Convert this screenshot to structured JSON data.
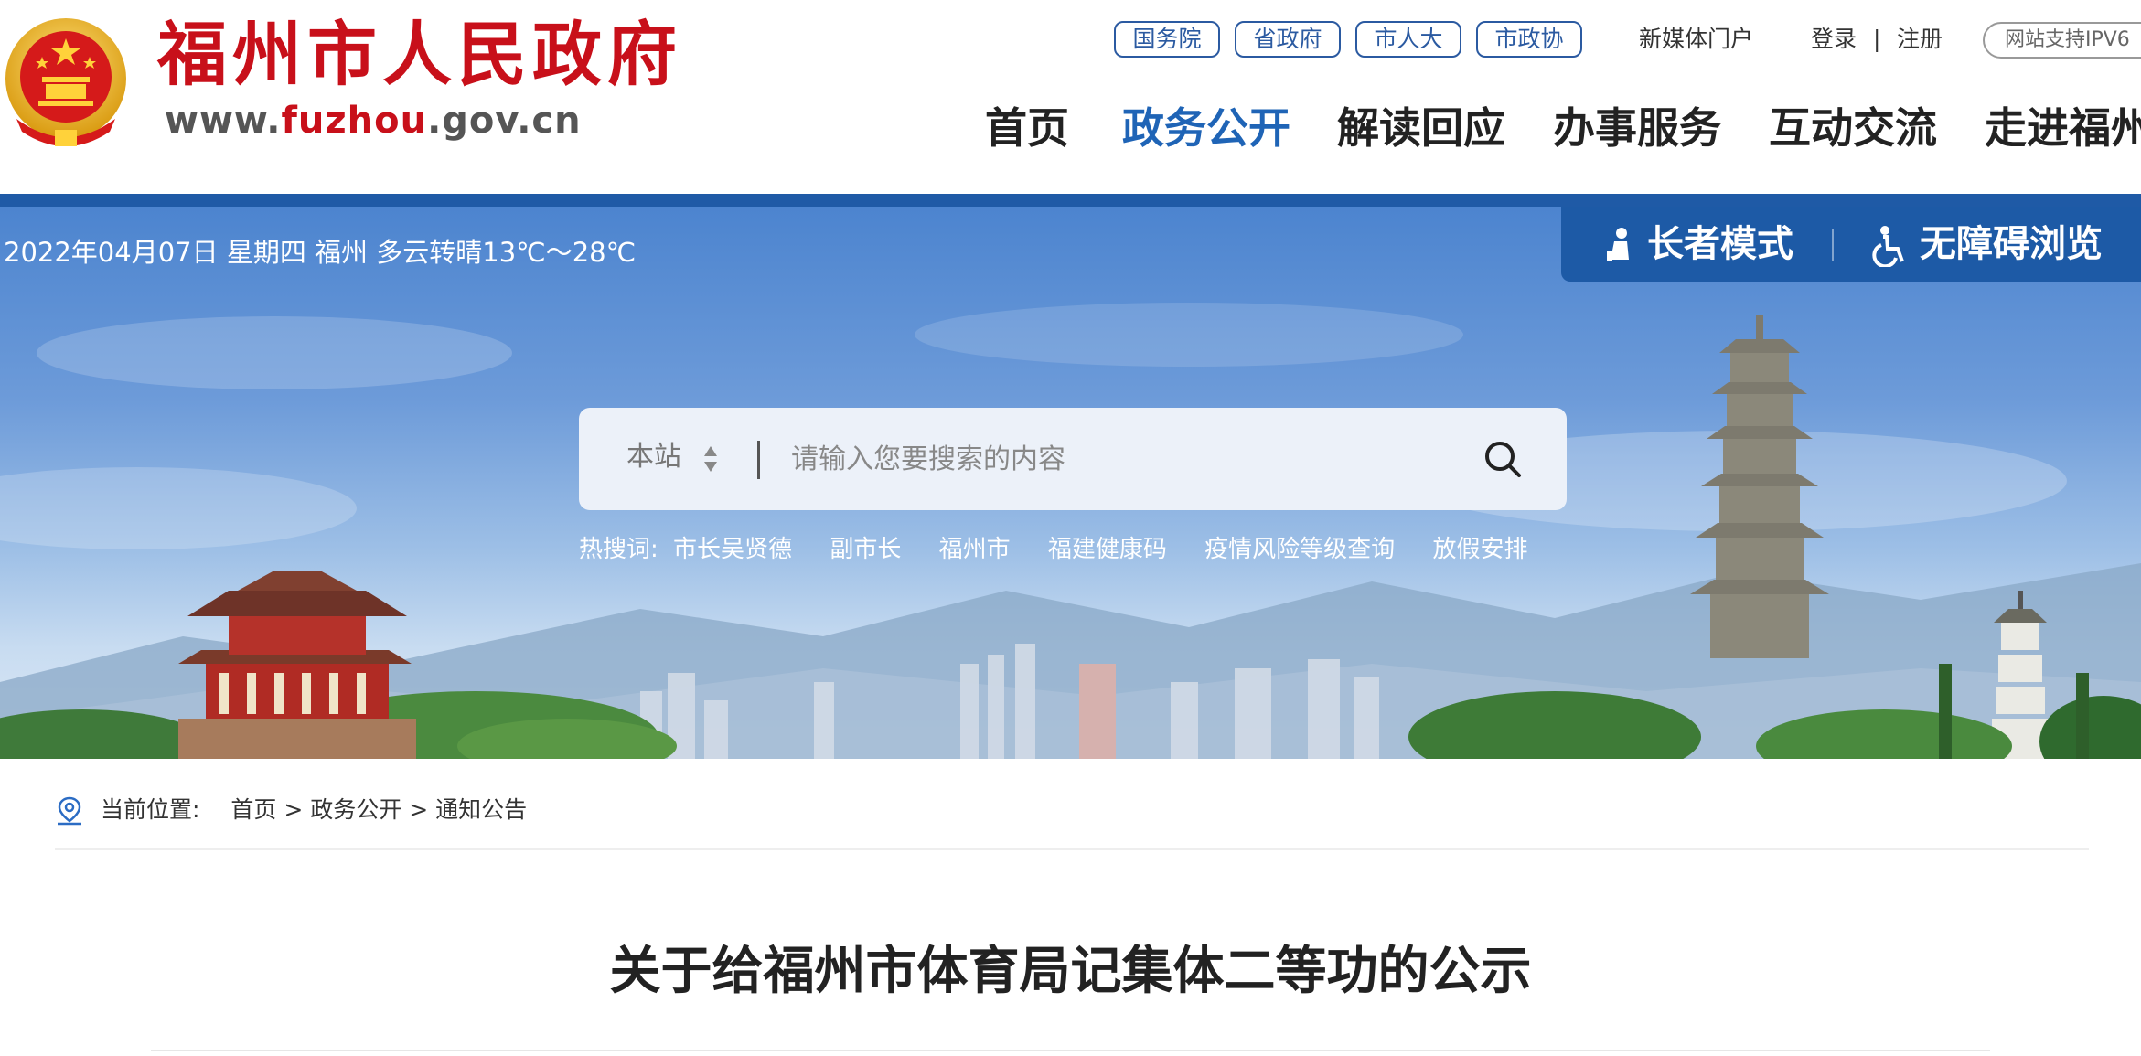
{
  "header": {
    "title": "福州市人民政府",
    "url_parts": [
      "www.",
      "fuzhou",
      ".gov.cn"
    ],
    "quick_links": [
      "国务院",
      "省政府",
      "市人大",
      "市政协"
    ],
    "media_portal": "新媒体门户",
    "login": "登录",
    "separator": "|",
    "register": "注册",
    "ipv6_badge": "网站支持IPV6",
    "nav": [
      "首页",
      "政务公开",
      "解读回应",
      "办事服务",
      "互动交流",
      "走进福州"
    ],
    "active_nav": "政务公开"
  },
  "banner": {
    "date_weather": "2022年04月07日 星期四 福州 多云转晴13℃～28℃",
    "elder_mode": "长者模式",
    "accessible": "无障碍浏览",
    "search": {
      "scope": "本站",
      "placeholder": "请输入您要搜索的内容"
    },
    "hot_label": "热搜词:",
    "hot_words": [
      "市长吴贤德",
      "副市长",
      "福州市",
      "福建健康码",
      "疫情风险等级查询",
      "放假安排"
    ]
  },
  "breadcrumb": {
    "label": "当前位置:",
    "items": [
      "首页",
      "政务公开",
      "通知公告"
    ],
    "sep": ">"
  },
  "article": {
    "title": "关于给福州市体育局记集体二等功的公示"
  },
  "colors": {
    "brand_red": "#c8101a",
    "nav_blue": "#1f64b6",
    "strip_blue": "#1f5aa6"
  },
  "icons": [
    "national-emblem-icon",
    "elder-mode-icon",
    "wheelchair-icon",
    "sort-arrows-icon",
    "search-icon",
    "location-pin-icon"
  ]
}
